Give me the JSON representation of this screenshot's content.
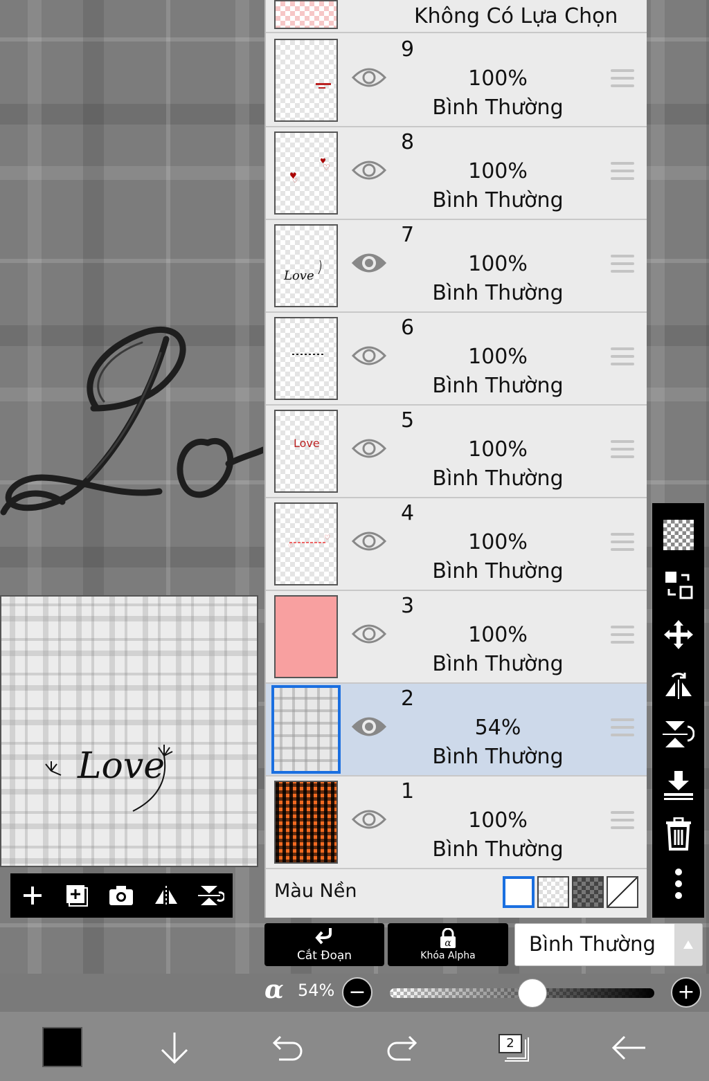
{
  "layers_panel": {
    "no_selection_label": "Không Có Lựa Chọn",
    "layers": [
      {
        "number": "9",
        "opacity": "100%",
        "blend": "Bình Thường",
        "visible": true,
        "selected": false,
        "thumb": "tiny-red-text"
      },
      {
        "number": "8",
        "opacity": "100%",
        "blend": "Bình Thường",
        "visible": true,
        "selected": false,
        "thumb": "hearts"
      },
      {
        "number": "7",
        "opacity": "100%",
        "blend": "Bình Thường",
        "visible": true,
        "selected": false,
        "thumb": "love-script"
      },
      {
        "number": "6",
        "opacity": "100%",
        "blend": "Bình Thường",
        "visible": true,
        "selected": false,
        "thumb": "dashed-line"
      },
      {
        "number": "5",
        "opacity": "100%",
        "blend": "Bình Thường",
        "visible": true,
        "selected": false,
        "thumb": "love-text",
        "thumb_text": "Love"
      },
      {
        "number": "4",
        "opacity": "100%",
        "blend": "Bình Thường",
        "visible": true,
        "selected": false,
        "thumb": "pink-hearts-line"
      },
      {
        "number": "3",
        "opacity": "100%",
        "blend": "Bình Thường",
        "visible": true,
        "selected": false,
        "thumb": "solid-pink"
      },
      {
        "number": "2",
        "opacity": "54%",
        "blend": "Bình Thường",
        "visible": true,
        "selected": true,
        "thumb": "gray-plaid"
      },
      {
        "number": "1",
        "opacity": "100%",
        "blend": "Bình Thường",
        "visible": true,
        "selected": false,
        "thumb": "orange-gingham"
      }
    ],
    "background_color_label": "Màu Nền"
  },
  "actions": {
    "clipping_label": "Cắt Đoạn",
    "alpha_lock_label": "Khóa Alpha",
    "blend_mode_value": "Bình Thường"
  },
  "opacity": {
    "symbol": "α",
    "value_label": "54%",
    "value": 0.54,
    "minus": "−",
    "plus": "+"
  },
  "bottom_bar": {
    "layers_count": "2"
  },
  "preview_text": "Love",
  "colors": {
    "selected_row": "#cdd9ea",
    "accent_blue": "#1a6fe0",
    "pink_fill": "#f8a0a0",
    "orange": "#f26a21"
  },
  "icons": {
    "mini_toolbar": [
      "add-layer-icon",
      "add-layer-copy-icon",
      "camera-icon",
      "flip-horizontal-icon",
      "flip-vertical-icon"
    ],
    "right_toolbar": [
      "transparency-icon",
      "swap-icon",
      "move-icon",
      "flip-horizontal-icon",
      "flip-vertical-icon",
      "merge-down-icon",
      "trash-icon",
      "more-icon"
    ],
    "bottom_bar": [
      "color-swatch",
      "download-icon",
      "undo-icon",
      "redo-icon",
      "layers-icon",
      "back-icon"
    ]
  }
}
